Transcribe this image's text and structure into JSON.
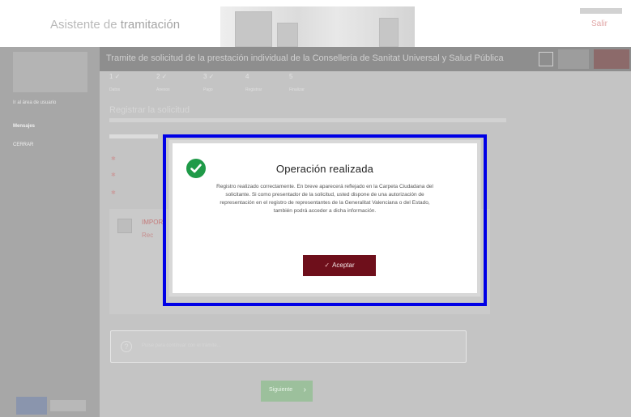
{
  "header": {
    "app_title_prefix": "Asistente de",
    "app_title_accent": "tramitación",
    "top_right_link": "Salir"
  },
  "sidebar": {
    "link": "Ir al área de usuario",
    "section_title": "Mensajes",
    "row_text": "CERRAR"
  },
  "process": {
    "title": "Tramite de solicitud de la prestación individual de la Consellería de Sanitat Universal y Salud Pública"
  },
  "steps": [
    {
      "num": "1 ✓",
      "label": "Datos"
    },
    {
      "num": "2 ✓",
      "label": "Anexos"
    },
    {
      "num": "3 ✓",
      "label": "Pago"
    },
    {
      "num": "4",
      "label": "Registrar"
    },
    {
      "num": "5",
      "label": "Finalizar"
    }
  ],
  "form": {
    "section_heading": "Registrar la solicitud",
    "required_rows": [
      "✱",
      "✱",
      "✱"
    ],
    "card_line1": "IMPOR",
    "card_line2": "Rec"
  },
  "info_box": {
    "icon": "info-circle-icon",
    "text": "Pulse para continuar con el trámite..."
  },
  "next_button": {
    "label": "Siguiente",
    "arrow": "›"
  },
  "modal": {
    "title": "Operación realizada",
    "body": "Registro realizado correctamente. En breve aparecerá reflejado en la Carpeta Ciudadana del solicitante. Si como presentador de la solicitud, usted dispone de una autorización de representación en el registro de representantes de la Generalitat Valenciana o del Estado, también podrá acceder a dicha información.",
    "accept_label": "Aceptar",
    "accept_icon": "✓",
    "status_icon": "check-circle-icon",
    "accent_color": "#6e0f1b",
    "success_color": "#1f9a48",
    "highlight_color": "#0000e6"
  }
}
